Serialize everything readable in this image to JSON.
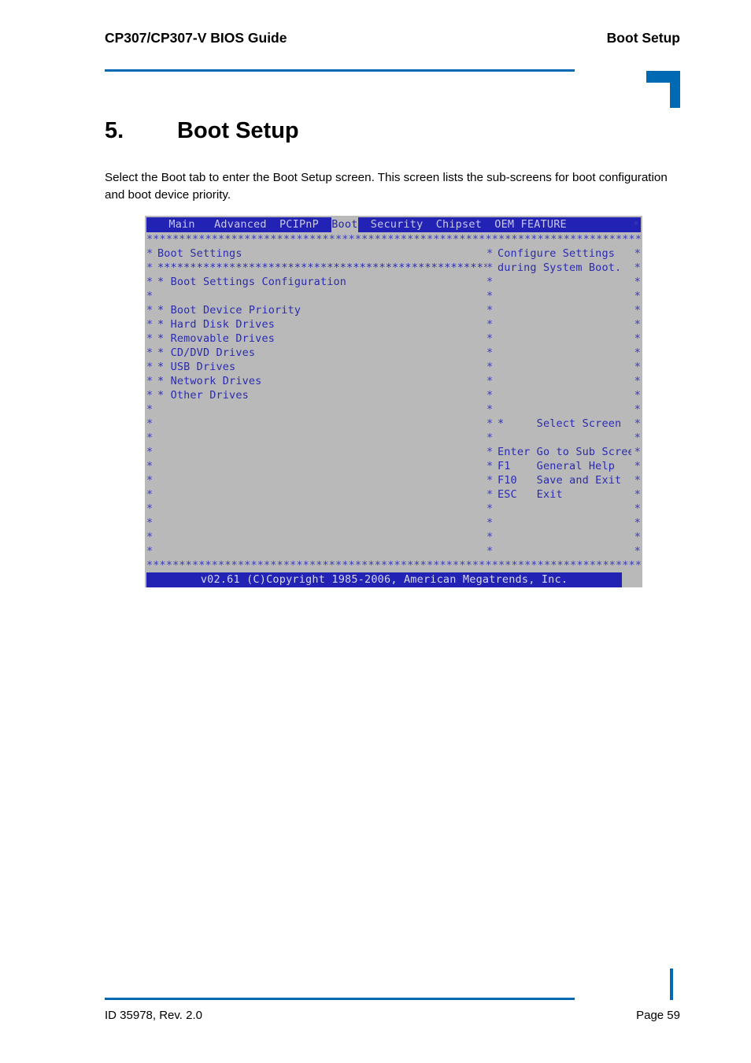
{
  "header": {
    "title": "CP307/CP307-V BIOS Guide",
    "chapter": "Boot Setup"
  },
  "chapter": {
    "number": "5.",
    "name": "Boot Setup"
  },
  "intro": "Select the Boot tab to enter the Boot Setup screen. This screen lists the sub-screens for boot configuration and boot device priority.",
  "bios": {
    "menu_tabs": [
      {
        "label": "Main",
        "active": false
      },
      {
        "label": "Advanced",
        "active": false
      },
      {
        "label": "PCIPnP",
        "active": false
      },
      {
        "label": "Boot",
        "active": true
      },
      {
        "label": "Security",
        "active": false
      },
      {
        "label": "Chipset",
        "active": false
      },
      {
        "label": "OEM FEATURE",
        "active": false
      }
    ],
    "menubar_edge_star": "*",
    "rule_top": "*********************************************************************************",
    "rule_bottom": "*********************************************************************************",
    "panel_title": "Boot Settings",
    "panel_title_underline": "*********************************************************",
    "left_items": [
      {
        "bullet": "*",
        "label": "Boot Settings Configuration",
        "selected": true
      },
      {
        "bullet": "",
        "label": "",
        "selected": false
      },
      {
        "bullet": "*",
        "label": "Boot Device Priority",
        "selected": false
      },
      {
        "bullet": "*",
        "label": "Hard Disk Drives",
        "selected": false
      },
      {
        "bullet": "*",
        "label": "Removable Drives",
        "selected": false
      },
      {
        "bullet": "*",
        "label": "CD/DVD Drives",
        "selected": false
      },
      {
        "bullet": "*",
        "label": "USB Drives",
        "selected": false
      },
      {
        "bullet": "*",
        "label": "Network Drives",
        "selected": false
      },
      {
        "bullet": "*",
        "label": "Other Drives",
        "selected": false
      }
    ],
    "help_text": [
      "Configure Settings",
      "during System Boot."
    ],
    "legend": [
      {
        "key": "*",
        "action": "Select Screen"
      },
      {
        "key": "",
        "action": ""
      },
      {
        "key": "Enter",
        "action": "Go to Sub Screen"
      },
      {
        "key": "F1",
        "action": "General Help"
      },
      {
        "key": "F10",
        "action": "Save and Exit"
      },
      {
        "key": "ESC",
        "action": "Exit"
      }
    ],
    "statusbar": "v02.61 (C)Copyright 1985-2006, American Megatrends, Inc.",
    "edge_char": "*",
    "colors": {
      "menu_blue": "#2222b4",
      "panel_gray": "#b9b9b9",
      "text_blue": "#2b2bb0",
      "selected_white": "#f2f2f2"
    }
  },
  "footer": {
    "left": "ID 35978, Rev. 2.0",
    "right": "Page 59"
  },
  "accent_color": "#0069b4"
}
